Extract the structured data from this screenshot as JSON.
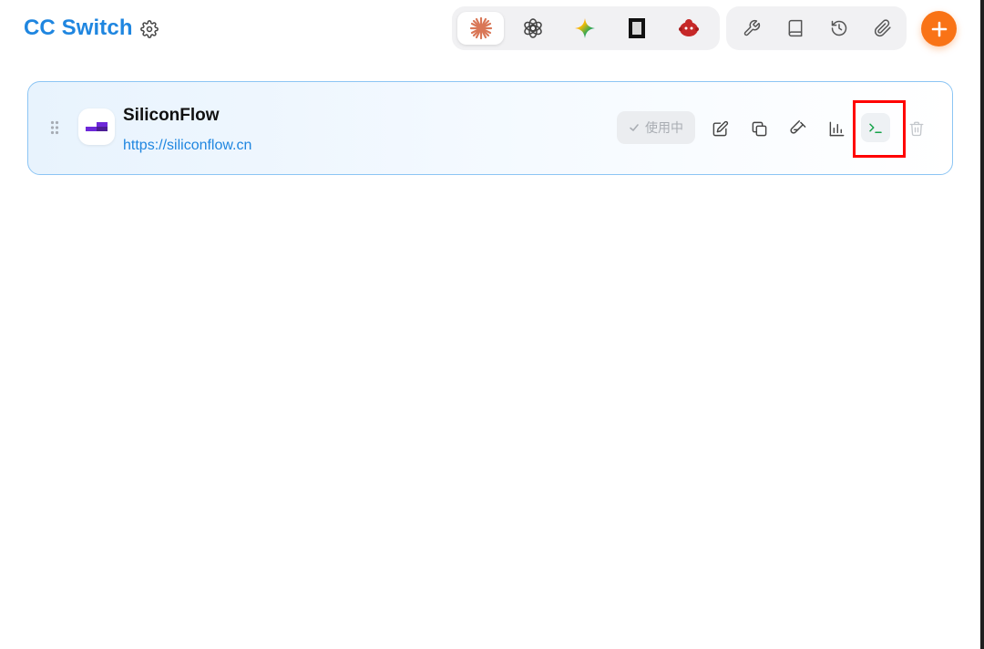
{
  "app": {
    "title": "CC Switch"
  },
  "header": {
    "settings_icon": "gear-icon",
    "app_tabs": [
      {
        "id": "claude",
        "icon": "claude-sunburst-icon",
        "active": true
      },
      {
        "id": "codex",
        "icon": "openai-knot-icon",
        "active": false
      },
      {
        "id": "gemini",
        "icon": "gemini-sparkle-icon",
        "active": false
      },
      {
        "id": "opencode",
        "icon": "opencode-square-icon",
        "active": false
      },
      {
        "id": "other",
        "icon": "red-mascot-icon",
        "active": false
      }
    ],
    "tool_buttons": [
      {
        "id": "tools",
        "icon": "wrench-icon"
      },
      {
        "id": "docs",
        "icon": "book-icon"
      },
      {
        "id": "history",
        "icon": "history-icon"
      },
      {
        "id": "attachments",
        "icon": "paperclip-icon"
      }
    ],
    "add_icon": "plus-icon"
  },
  "provider": {
    "name": "SiliconFlow",
    "url": "https://siliconflow.cn",
    "status_label": "使用中",
    "actions": [
      "edit-icon",
      "copy-icon",
      "test-icon",
      "stats-icon",
      "terminal-icon",
      "trash-icon"
    ]
  },
  "colors": {
    "brand": "#1f86e0",
    "add_button": "#f97316",
    "card_border": "#8cc5f4",
    "highlight": "#ff0000",
    "terminal_accent": "#16a34a"
  }
}
